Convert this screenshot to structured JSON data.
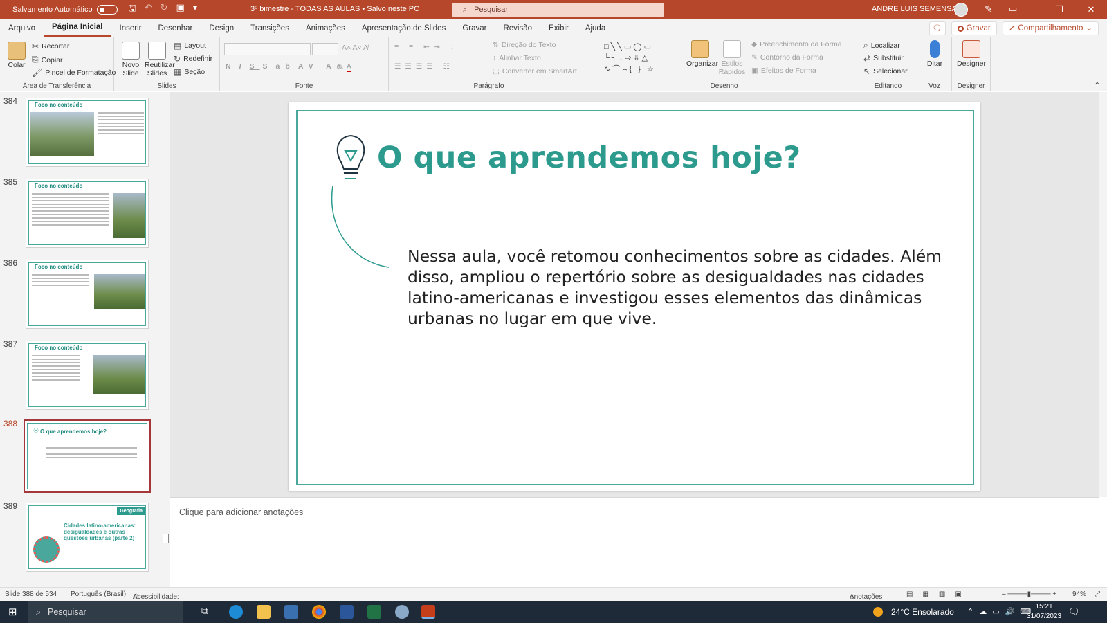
{
  "titlebar": {
    "autosave_label": "Salvamento Automático",
    "doc_title": "3º bimestre - TODAS AS AULAS  •  Salvo neste PC",
    "search_placeholder": "Pesquisar",
    "user_name": "ANDRE LUIS SEMENSATO",
    "accent": "#b7472a"
  },
  "menu": {
    "tabs": [
      "Arquivo",
      "Página Inicial",
      "Inserir",
      "Desenhar",
      "Design",
      "Transições",
      "Animações",
      "Apresentação de Slides",
      "Gravar",
      "Revisão",
      "Exibir",
      "Ajuda"
    ],
    "active_tab": "Página Inicial",
    "record_label": "Gravar",
    "share_label": "Compartilhamento"
  },
  "ribbon": {
    "clipboard": {
      "paste": "Colar",
      "cut": "Recortar",
      "copy": "Copiar",
      "format_painter": "Pincel de Formatação",
      "label": "Área de Transferência"
    },
    "slides": {
      "new": "Novo",
      "new2": "Slide",
      "reuse": "Reutilizar",
      "reuse2": "Slides",
      "layout": "Layout",
      "reset": "Redefinir",
      "section": "Seção",
      "label": "Slides"
    },
    "font": {
      "label": "Fonte"
    },
    "paragraph": {
      "text_direction": "Direção do Texto",
      "align_text": "Alinhar Texto",
      "smartart": "Converter em SmartArt",
      "label": "Parágrafo"
    },
    "drawing": {
      "arrange": "Organizar",
      "quick_styles": "Estilos",
      "quick_styles2": "Rápidos",
      "fill": "Preenchimento da Forma",
      "outline": "Contorno da Forma",
      "effects": "Efeitos de Forma",
      "label": "Desenho"
    },
    "editing": {
      "find": "Localizar",
      "replace": "Substituir",
      "select": "Selecionar",
      "label": "Editando"
    },
    "voice": {
      "dictate": "Ditar",
      "label": "Voz"
    },
    "designer": {
      "designer": "Designer",
      "label": "Designer"
    }
  },
  "thumbnails": [
    {
      "num": "384",
      "title": "Foco no conteúdo"
    },
    {
      "num": "385",
      "title": "Foco no conteúdo"
    },
    {
      "num": "386",
      "title": "Foco no conteúdo"
    },
    {
      "num": "387",
      "title": "Foco no conteúdo"
    },
    {
      "num": "388",
      "title": "O que aprendemos hoje?",
      "selected": true
    },
    {
      "num": "389",
      "title": "Cidades latino-americanas: desigualdades e outras questões urbanas (parte 2)",
      "badge": "Geografia"
    }
  ],
  "slide": {
    "title": "O que aprendemos hoje?",
    "body": "Nessa aula, você retomou conhecimentos sobre as cidades. Além disso, ampliou o repertório sobre as desigualdades nas cidades latino-americanas e investigou esses elementos das dinâmicas urbanas no lugar em que vive.",
    "accent": "#2d9a8e"
  },
  "notes_placeholder": "Clique para adicionar anotações",
  "statusbar": {
    "slide_info": "Slide 388 de 534",
    "language": "Português (Brasil)",
    "accessibility": "Acessibilidade: investigar",
    "notes": "Anotações",
    "zoom": "94%"
  },
  "taskbar": {
    "search": "Pesquisar",
    "weather": "24°C  Ensolarado",
    "time": "15:21",
    "date": "31/07/2023"
  }
}
